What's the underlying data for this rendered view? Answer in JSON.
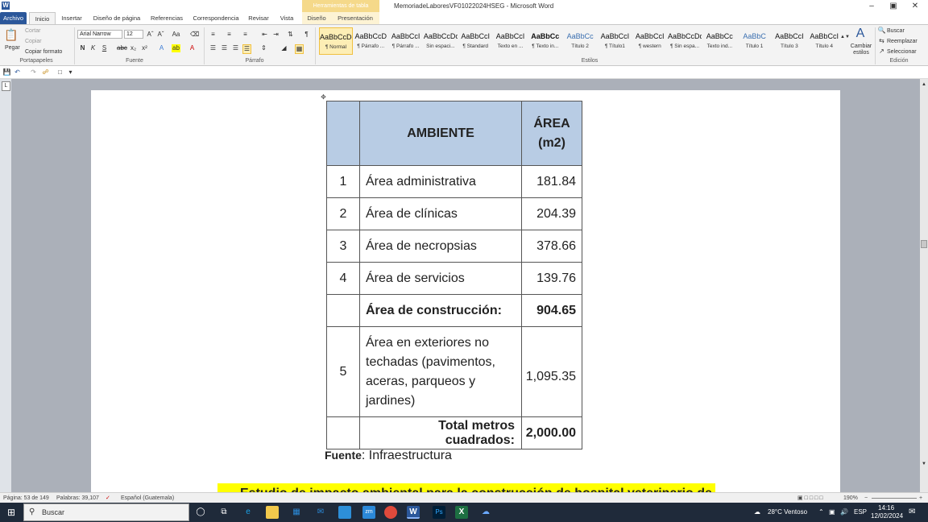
{
  "app": {
    "title": "MemoriadeLaboresVF01022024HSEG - Microsoft Word",
    "context_tab": "Herramientas de tabla",
    "icon_letter": "W"
  },
  "window_buttons": [
    "–",
    "▣",
    "✕"
  ],
  "tabs": [
    "Archivo",
    "Inicio",
    "Insertar",
    "Diseño de página",
    "Referencias",
    "Correspondencia",
    "Revisar",
    "Vista",
    "Diseño",
    "Presentación"
  ],
  "ribbon": {
    "clipboard": {
      "paste": "Pegar",
      "cut": "Cortar",
      "copy": "Copiar",
      "format_painter": "Copiar formato",
      "group": "Portapapeles"
    },
    "font": {
      "name": "Arial Narrow",
      "size": "12",
      "group": "Fuente"
    },
    "paragraph": {
      "group": "Párrafo"
    },
    "styles": {
      "group": "Estilos",
      "items": [
        {
          "preview": "AaBbCcDc",
          "name": "¶ Normal"
        },
        {
          "preview": "AaBbCcD",
          "name": "¶ Párrafo ..."
        },
        {
          "preview": "AaBbCcI",
          "name": "¶ Párrafo ..."
        },
        {
          "preview": "AaBbCcDc",
          "name": "Sin espaci..."
        },
        {
          "preview": "AaBbCcI",
          "name": "¶ Standard"
        },
        {
          "preview": "AaBbCcI",
          "name": "Texto en ..."
        },
        {
          "preview": "AaBbCc",
          "name": "¶ Texto in..."
        },
        {
          "preview": "AaBbCc",
          "name": "Título 2"
        },
        {
          "preview": "AaBbCcI",
          "name": "¶ Título1"
        },
        {
          "preview": "AaBbCcI",
          "name": "¶ western"
        },
        {
          "preview": "AaBbCcDdI",
          "name": "¶ Sin espa..."
        },
        {
          "preview": "AaBbCc",
          "name": "Texto ind..."
        },
        {
          "preview": "AaBbC",
          "name": "Título 1"
        },
        {
          "preview": "AaBbCcI",
          "name": "Título 3"
        },
        {
          "preview": "AaBbCcI",
          "name": "Título 4"
        }
      ],
      "change": "Cambiar estilos"
    },
    "editing": {
      "find": "Buscar",
      "replace": "Reemplazar",
      "select": "Seleccionar",
      "group": "Edición"
    }
  },
  "table": {
    "header": {
      "col2": "AMBIENTE",
      "col3_line1": "ÁREA",
      "col3_line2": "(m2)"
    },
    "rows": [
      {
        "num": "1",
        "name": "Área administrativa",
        "area": "181.84"
      },
      {
        "num": "2",
        "name": "Área de clínicas",
        "area": "204.39"
      },
      {
        "num": "3",
        "name": "Área de necropsias",
        "area": "378.66"
      },
      {
        "num": "4",
        "name": "Área de servicios",
        "area": "139.76"
      }
    ],
    "subtotal": {
      "name": "Área de construcción:",
      "area": "904.65"
    },
    "exterior": {
      "num": "5",
      "lines": [
        "Área en exteriores no",
        "techadas (pavimentos,",
        "aceras, parqueos y",
        "jardines)"
      ],
      "area": "1,095.35"
    },
    "total": {
      "name": "Total metros cuadrados:",
      "area": "2,000.00"
    }
  },
  "source": {
    "label": "Fuente",
    "text": ": Infraestructura"
  },
  "next_heading": "Estudio de impacto ambiental para la construcción de hospital veterinario de la",
  "status": {
    "page": "Página: 53 de 149",
    "words": "Palabras: 39,107",
    "language": "Español (Guatemala)",
    "zoom": "190%"
  },
  "taskbar": {
    "search": "Buscar",
    "weather": "28°C  Ventoso",
    "lang": "ESP",
    "time": "14:16",
    "date": "12/02/2024"
  },
  "colors": {
    "header_fill": "#b8cce4",
    "highlight": "#ffff00",
    "file_tab": "#2b579a",
    "workspace": "#abb0b9"
  }
}
